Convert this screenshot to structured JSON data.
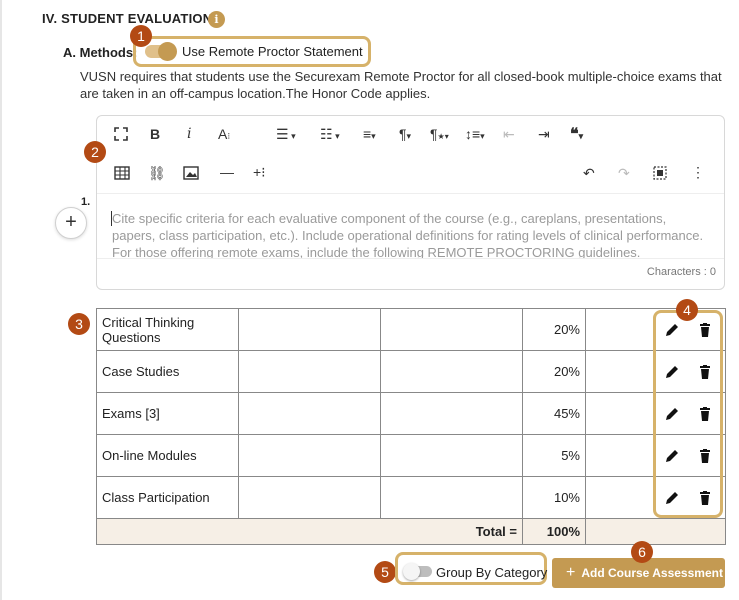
{
  "section": {
    "title": "IV. STUDENT EVALUATION",
    "info_icon": "info-icon"
  },
  "methods": {
    "label": "A. Methods:",
    "toggle_label": "Use Remote Proctor Statement",
    "toggle_on": true,
    "description": "VUSN requires that students use the Securexam Remote Proctor for all closed-book multiple-choice exams that are taken in an off-campus location.The Honor Code applies."
  },
  "editor": {
    "list_number": "1.",
    "placeholder": "Cite specific criteria for each evaluative component of the course (e.g., careplans, presentations, papers, class participation, etc.). Include operational definitions for rating levels of clinical performance. For those offering remote exams, include the following REMOTE PROCTORING guidelines.",
    "char_count": "Characters : 0"
  },
  "table": {
    "rows": [
      {
        "name": "Critical Thinking Questions",
        "weight": "20%"
      },
      {
        "name": "Case Studies",
        "weight": "20%"
      },
      {
        "name": "Exams [3]",
        "weight": "45%"
      },
      {
        "name": "On-line Modules",
        "weight": "5%"
      },
      {
        "name": "Class Participation",
        "weight": "10%"
      }
    ],
    "total_label": "Total =",
    "total_value": "100%"
  },
  "footer": {
    "group_toggle_label": "Group By Category",
    "group_toggle_on": false,
    "add_button_label": "Add Course Assessment"
  },
  "callouts": [
    "1",
    "2",
    "3",
    "4",
    "5",
    "6"
  ],
  "colors": {
    "accent": "#c49a52",
    "callout": "#b34a14",
    "highlight": "#d6b26a",
    "total_bg": "#f6efe6"
  }
}
